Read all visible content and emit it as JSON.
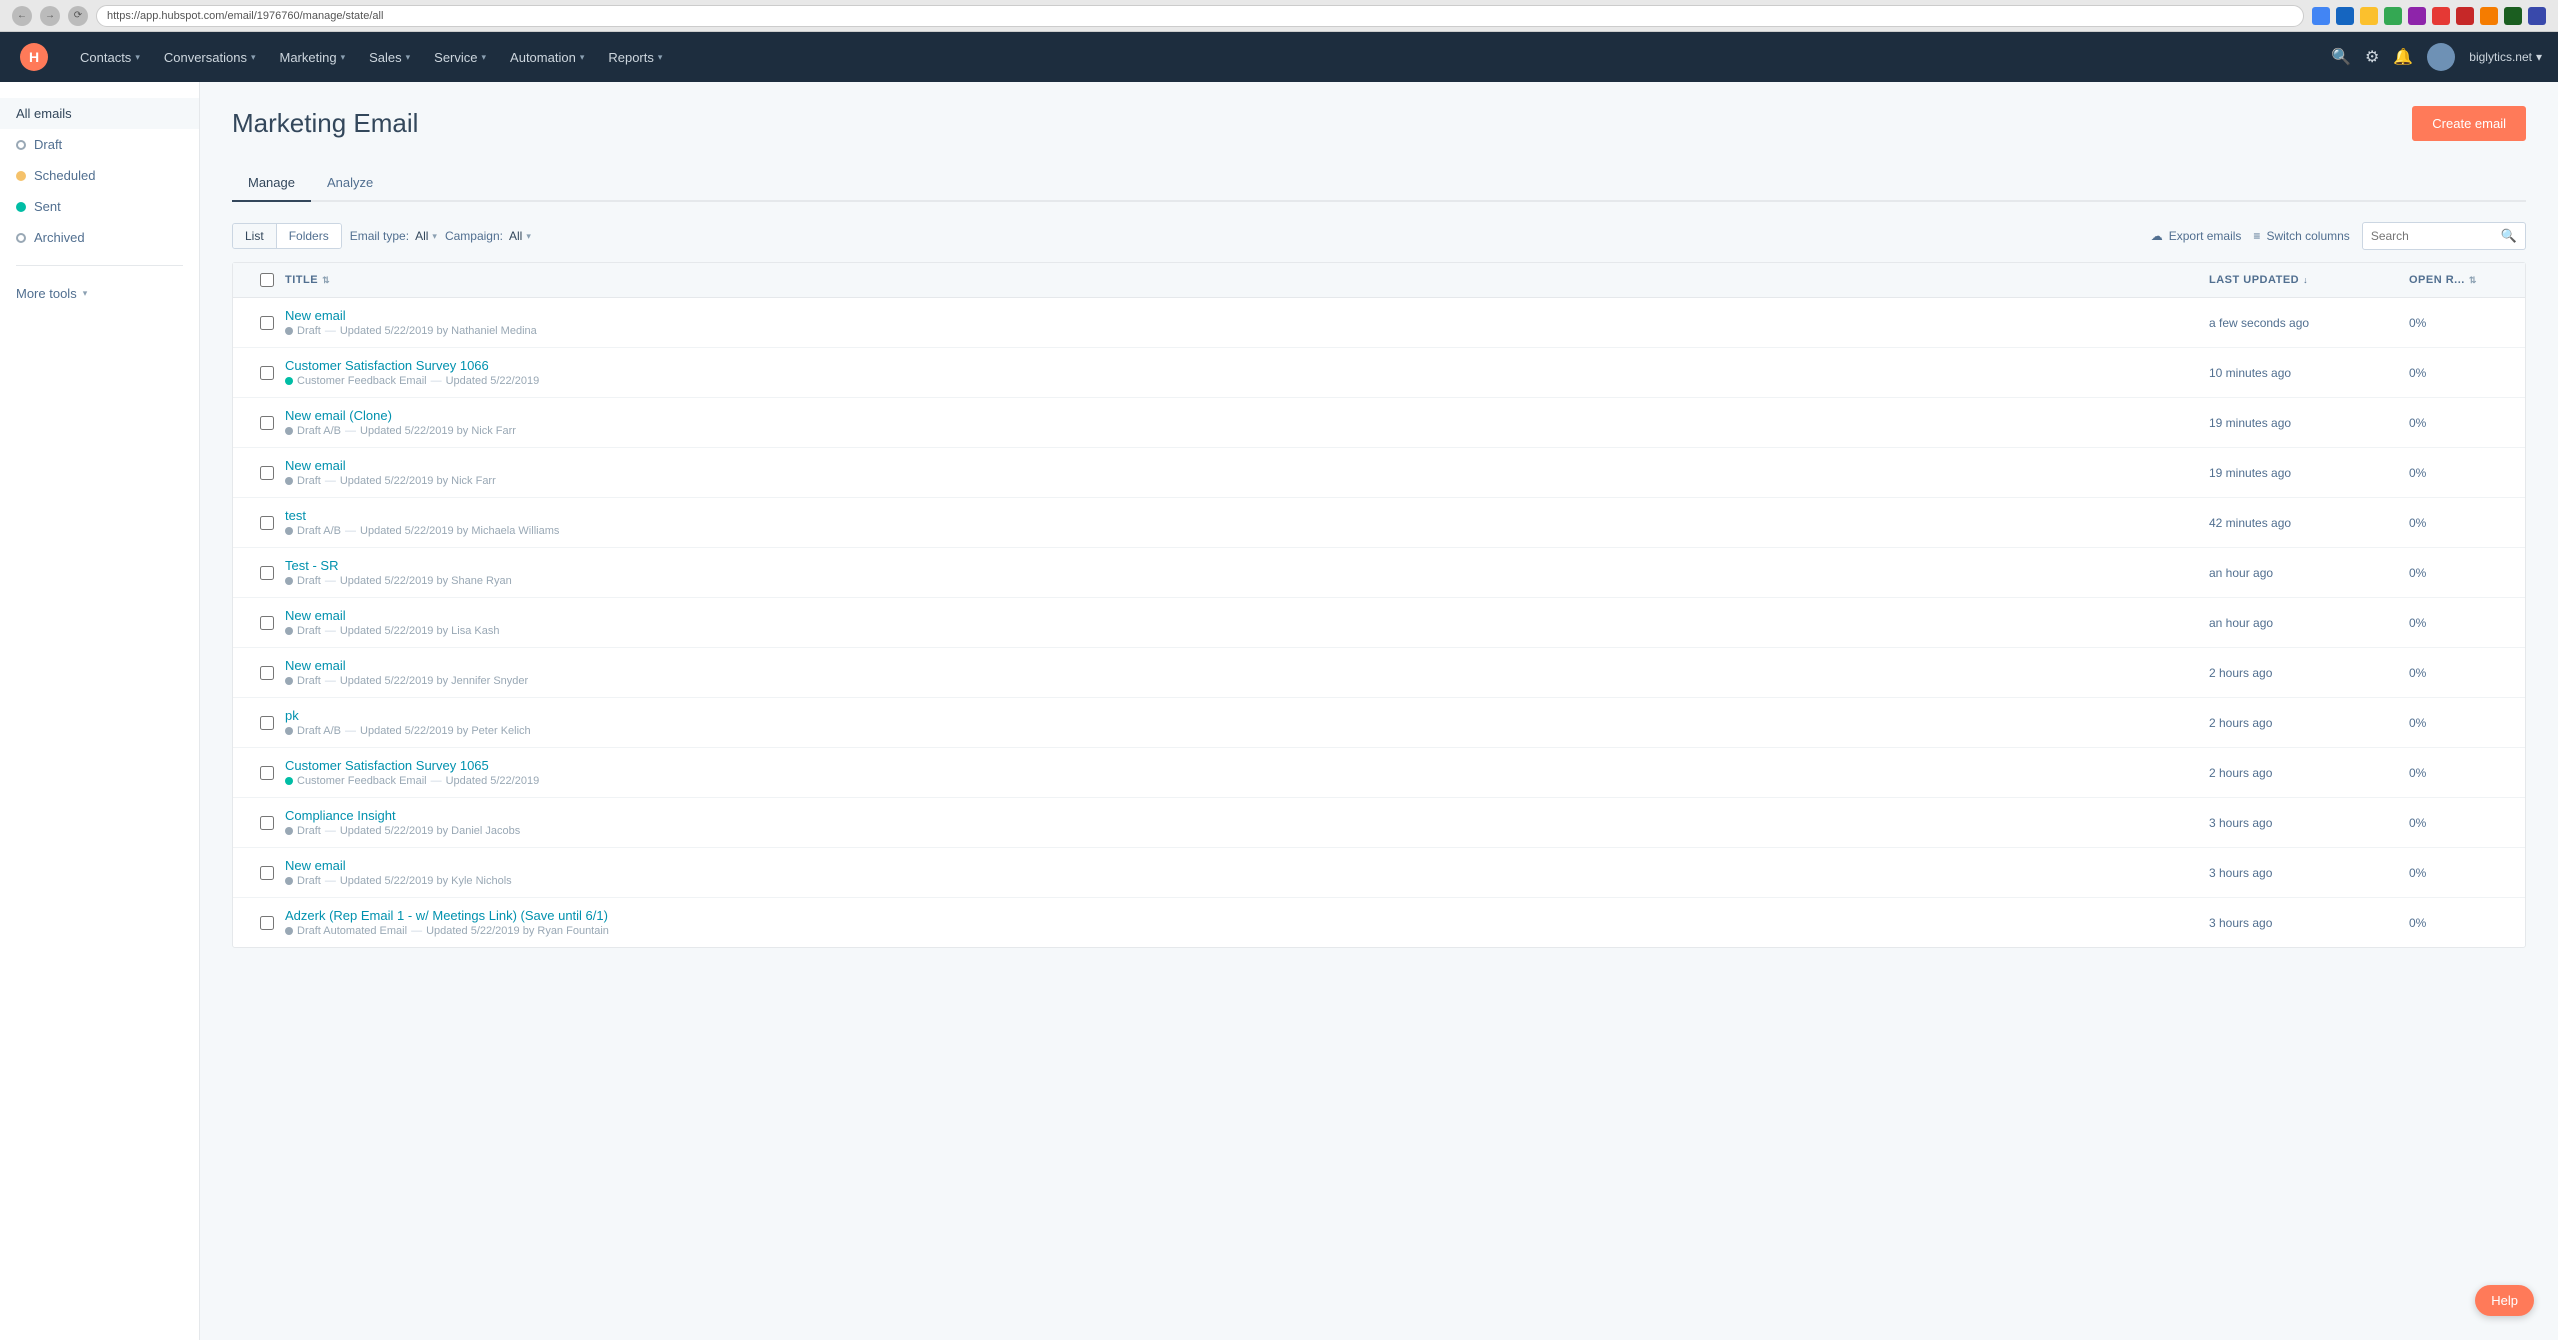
{
  "browser": {
    "url": "https://app.hubspot.com/email/1976760/manage/state/all"
  },
  "nav": {
    "logo_alt": "HubSpot",
    "items": [
      {
        "label": "Contacts",
        "id": "contacts"
      },
      {
        "label": "Conversations",
        "id": "conversations"
      },
      {
        "label": "Marketing",
        "id": "marketing"
      },
      {
        "label": "Sales",
        "id": "sales"
      },
      {
        "label": "Service",
        "id": "service"
      },
      {
        "label": "Automation",
        "id": "automation"
      },
      {
        "label": "Reports",
        "id": "reports"
      }
    ],
    "account": "biglytics.net"
  },
  "page": {
    "title": "Marketing Email",
    "create_btn": "Create email"
  },
  "tabs": [
    {
      "label": "Manage",
      "id": "manage",
      "active": true
    },
    {
      "label": "Analyze",
      "id": "analyze",
      "active": false
    }
  ],
  "toolbar": {
    "list_btn": "List",
    "folders_btn": "Folders",
    "email_type_label": "Email type:",
    "email_type_value": "All",
    "campaign_label": "Campaign:",
    "campaign_value": "All",
    "export_label": "Export emails",
    "switch_columns_label": "Switch columns",
    "search_placeholder": "Search"
  },
  "sidebar": {
    "all_emails": "All emails",
    "items": [
      {
        "label": "Draft",
        "dot": "gray-hollow",
        "id": "draft"
      },
      {
        "label": "Scheduled",
        "dot": "yellow",
        "id": "scheduled"
      },
      {
        "label": "Sent",
        "dot": "green",
        "id": "sent"
      },
      {
        "label": "Archived",
        "dot": "gray-hollow",
        "id": "archived"
      }
    ],
    "more_tools": "More tools"
  },
  "email_list": {
    "columns": [
      {
        "label": "TITLE",
        "id": "title",
        "sortable": true
      },
      {
        "label": "LAST UPDATED",
        "id": "last_updated",
        "sortable": true,
        "active": true
      },
      {
        "label": "OPEN R...",
        "id": "open_rate",
        "sortable": true
      }
    ],
    "emails": [
      {
        "id": 1,
        "title": "New email",
        "type": "Draft",
        "dot": "gray",
        "meta": "Updated 5/22/2019 by Nathaniel Medina",
        "last_updated": "a few seconds ago",
        "open_rate": "0%"
      },
      {
        "id": 2,
        "title": "Customer Satisfaction Survey 1066",
        "type": "Customer Feedback Email",
        "dot": "green",
        "meta": "Updated 5/22/2019",
        "last_updated": "10 minutes ago",
        "open_rate": "0%"
      },
      {
        "id": 3,
        "title": "New email (Clone)",
        "type": "Draft A/B",
        "dot": "gray",
        "meta": "Updated 5/22/2019 by Nick Farr",
        "last_updated": "19 minutes ago",
        "open_rate": "0%"
      },
      {
        "id": 4,
        "title": "New email",
        "type": "Draft",
        "dot": "gray",
        "meta": "Updated 5/22/2019 by Nick Farr",
        "last_updated": "19 minutes ago",
        "open_rate": "0%"
      },
      {
        "id": 5,
        "title": "test",
        "type": "Draft A/B",
        "dot": "gray",
        "meta": "Updated 5/22/2019 by Michaela Williams",
        "last_updated": "42 minutes ago",
        "open_rate": "0%"
      },
      {
        "id": 6,
        "title": "Test - SR",
        "type": "Draft",
        "dot": "gray",
        "meta": "Updated 5/22/2019 by Shane Ryan",
        "last_updated": "an hour ago",
        "open_rate": "0%"
      },
      {
        "id": 7,
        "title": "New email",
        "type": "Draft",
        "dot": "gray",
        "meta": "Updated 5/22/2019 by Lisa Kash",
        "last_updated": "an hour ago",
        "open_rate": "0%"
      },
      {
        "id": 8,
        "title": "New email",
        "type": "Draft",
        "dot": "gray",
        "meta": "Updated 5/22/2019 by Jennifer Snyder",
        "last_updated": "2 hours ago",
        "open_rate": "0%"
      },
      {
        "id": 9,
        "title": "pk",
        "type": "Draft A/B",
        "dot": "gray",
        "meta": "Updated 5/22/2019 by Peter Kelich",
        "last_updated": "2 hours ago",
        "open_rate": "0%"
      },
      {
        "id": 10,
        "title": "Customer Satisfaction Survey 1065",
        "type": "Customer Feedback Email",
        "dot": "green",
        "meta": "Updated 5/22/2019",
        "last_updated": "2 hours ago",
        "open_rate": "0%"
      },
      {
        "id": 11,
        "title": "Compliance Insight",
        "type": "Draft",
        "dot": "gray",
        "meta": "Updated 5/22/2019 by Daniel Jacobs",
        "last_updated": "3 hours ago",
        "open_rate": "0%"
      },
      {
        "id": 12,
        "title": "New email",
        "type": "Draft",
        "dot": "gray",
        "meta": "Updated 5/22/2019 by Kyle Nichols",
        "last_updated": "3 hours ago",
        "open_rate": "0%"
      },
      {
        "id": 13,
        "title": "Adzerk (Rep Email 1 - w/ Meetings Link) (Save until 6/1)",
        "type": "Draft Automated Email",
        "dot": "gray",
        "meta": "Updated 5/22/2019 by Ryan Fountain",
        "last_updated": "3 hours ago",
        "open_rate": "0%"
      }
    ]
  },
  "help_btn": "Help"
}
